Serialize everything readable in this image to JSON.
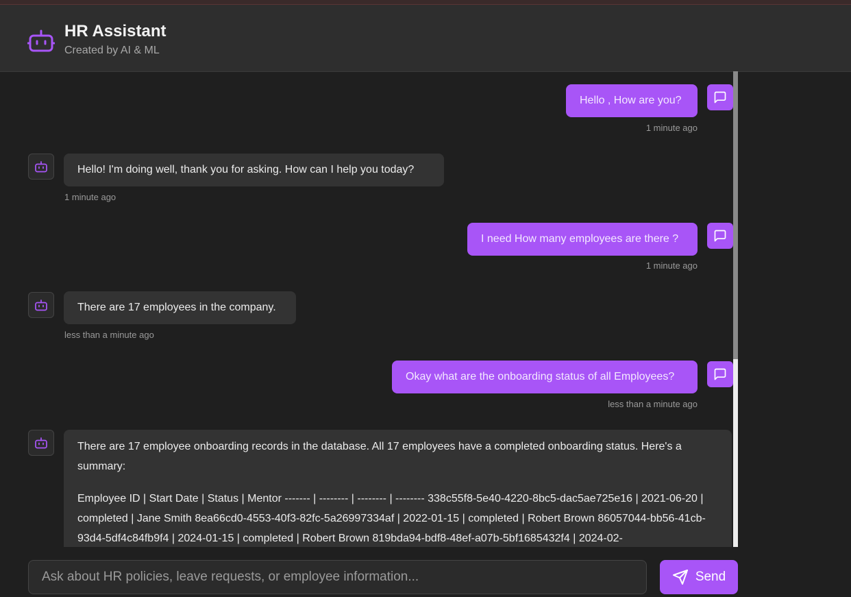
{
  "header": {
    "title": "HR Assistant",
    "subtitle": "Created by AI & ML",
    "icon": "robot-icon"
  },
  "messages": [
    {
      "role": "user",
      "text": "Hello , How are you?",
      "time": "1 minute ago"
    },
    {
      "role": "assistant",
      "text": "Hello! I'm doing well, thank you for asking. How can I help you today?",
      "time": "1 minute ago"
    },
    {
      "role": "user",
      "text": "I need How many employees are there ?",
      "time": "1 minute ago"
    },
    {
      "role": "assistant",
      "text": "There are 17 employees in the company.",
      "time": "less than a minute ago"
    },
    {
      "role": "user",
      "text": "Okay what are the onboarding status of all Employees?",
      "time": "less than a minute ago"
    },
    {
      "role": "assistant",
      "text_p1": "There are 17 employee onboarding records in the database. All 17 employees have a completed onboarding status. Here's a summary:",
      "text_p2": "Employee ID | Start Date | Status | Mentor ------- | -------- | -------- | -------- 338c55f8-5e40-4220-8bc5-dac5ae725e16 | 2021-06-20 | completed | Jane Smith 8ea66cd0-4553-40f3-82fc-5a26997334af | 2022-01-15 | completed | Robert Brown 86057044-bb56-41cb-93d4-5df4c84fb9f4 | 2024-01-15 | completed | Robert Brown 819bda94-bdf8-48ef-a07b-5bf1685432f4 | 2024-02-"
    }
  ],
  "composer": {
    "placeholder": "Ask about HR policies, leave requests, or employee information...",
    "send_label": "Send"
  },
  "colors": {
    "accent": "#a855f7",
    "background": "#1f1f1f",
    "header": "#2e2e2e",
    "bot_bubble": "#333333"
  }
}
